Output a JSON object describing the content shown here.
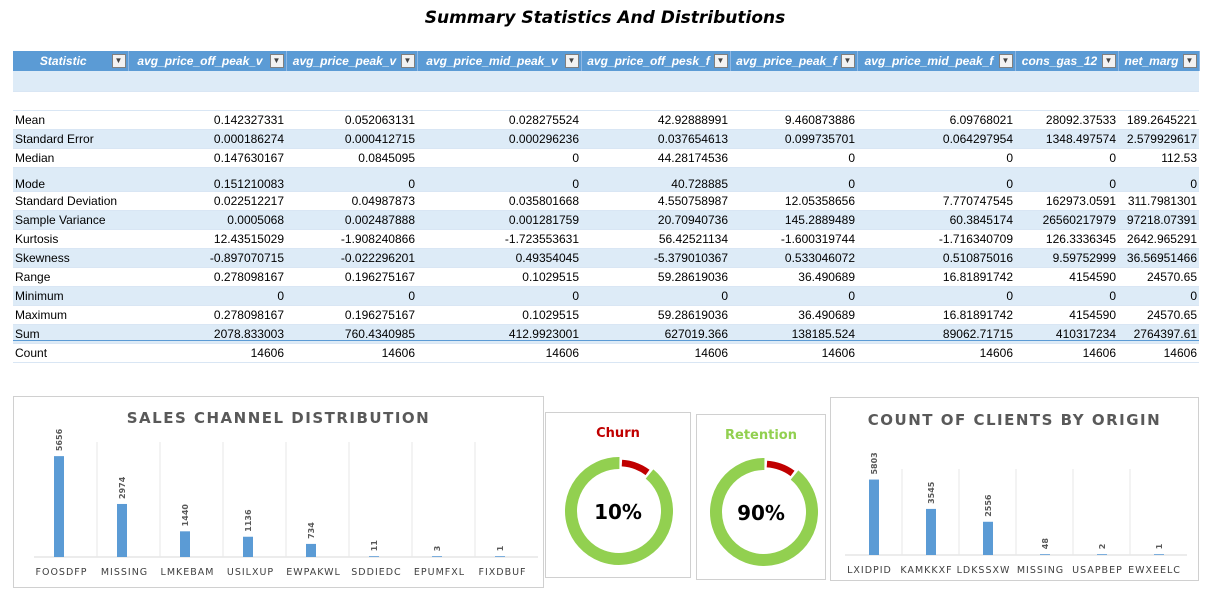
{
  "title": "Summary Statistics And Distributions",
  "table": {
    "headers": [
      "Statistic",
      "avg_price_off_peak_v",
      "avg_price_peak_v",
      "avg_price_mid_peak_v",
      "avg_price_off_pesk_f",
      "avg_price_peak_f",
      "avg_price_mid_peak_f",
      "cons_gas_12",
      "net_marg"
    ],
    "rows": [
      {
        "label": "Mean",
        "values": [
          "0.142327331",
          "0.052063131",
          "0.028275524",
          "42.92888991",
          "9.460873886",
          "6.09768021",
          "28092.37533",
          "189.2645221"
        ]
      },
      {
        "label": "Standard Error",
        "values": [
          "0.000186274",
          "0.000412715",
          "0.000296236",
          "0.037654613",
          "0.099735701",
          "0.064297954",
          "1348.497574",
          "2.579929617"
        ]
      },
      {
        "label": "Median",
        "values": [
          "0.147630167",
          "0.0845095",
          "0",
          "44.28174536",
          "0",
          "0",
          "0",
          "112.53"
        ]
      },
      {
        "label": "Mode",
        "values": [
          "0.151210083",
          "0",
          "0",
          "40.728885",
          "0",
          "0",
          "0",
          "0"
        ]
      },
      {
        "label": "Standard Deviation",
        "values": [
          "0.022512217",
          "0.04987873",
          "0.035801668",
          "4.550758987",
          "12.05358656",
          "7.770747545",
          "162973.0591",
          "311.7981301"
        ]
      },
      {
        "label": "Sample Variance",
        "values": [
          "0.0005068",
          "0.002487888",
          "0.001281759",
          "20.70940736",
          "145.2889489",
          "60.3845174",
          "26560217979",
          "97218.07391"
        ]
      },
      {
        "label": "Kurtosis",
        "values": [
          "12.43515029",
          "-1.908240866",
          "-1.723553631",
          "56.42521134",
          "-1.600319744",
          "-1.716340709",
          "126.3336345",
          "2642.965291"
        ]
      },
      {
        "label": "Skewness",
        "values": [
          "-0.897070715",
          "-0.022296201",
          "0.49354045",
          "-5.379010367",
          "0.533046072",
          "0.510875016",
          "9.59752999",
          "36.56951466"
        ]
      },
      {
        "label": "Range",
        "values": [
          "0.278098167",
          "0.196275167",
          "0.1029515",
          "59.28619036",
          "36.490689",
          "16.81891742",
          "4154590",
          "24570.65"
        ]
      },
      {
        "label": "Minimum",
        "values": [
          "0",
          "0",
          "0",
          "0",
          "0",
          "0",
          "0",
          "0"
        ]
      },
      {
        "label": "Maximum",
        "values": [
          "0.278098167",
          "0.196275167",
          "0.1029515",
          "59.28619036",
          "36.490689",
          "16.81891742",
          "4154590",
          "24570.65"
        ]
      },
      {
        "label": "Sum",
        "values": [
          "2078.833003",
          "760.4340985",
          "412.9923001",
          "627019.366",
          "138185.524",
          "89062.71715",
          "410317234",
          "2764397.61"
        ]
      },
      {
        "label": "Count",
        "values": [
          "14606",
          "14606",
          "14606",
          "14606",
          "14606",
          "14606",
          "14606",
          "14606"
        ]
      }
    ]
  },
  "chart_data": [
    {
      "type": "bar",
      "title": "SALES CHANNEL DISTRIBUTION",
      "categories": [
        "FOOSDFP",
        "MISSING",
        "LMKEBAM",
        "USILXUP",
        "EWPAKWL",
        "SDDIEDC",
        "EPUMFXL",
        "FIXDBUF"
      ],
      "values": [
        5656,
        2974,
        1440,
        1136,
        734,
        11,
        3,
        1
      ],
      "ylim": [
        0,
        6000
      ],
      "color": "#5b9bd5",
      "grid": false
    },
    {
      "type": "pie",
      "title": "Churn",
      "center_text": "10%",
      "values": [
        10,
        90
      ],
      "title_color": "#c00000",
      "colors": [
        "#c00000",
        "#92d050"
      ]
    },
    {
      "type": "pie",
      "title": "Retention",
      "center_text": "90%",
      "values": [
        10,
        90
      ],
      "title_color": "#92d050",
      "colors": [
        "#c00000",
        "#92d050"
      ]
    },
    {
      "type": "bar",
      "title": "COUNT OF CLIENTS BY ORIGIN",
      "categories": [
        "LXIDPID",
        "KAMKKXF",
        "LDKSSXW",
        "MISSING",
        "USAPBEP",
        "EWXEELC"
      ],
      "values": [
        5803,
        3545,
        2556,
        48,
        2,
        1
      ],
      "ylim": [
        0,
        6000
      ],
      "color": "#5b9bd5",
      "grid": false
    }
  ]
}
